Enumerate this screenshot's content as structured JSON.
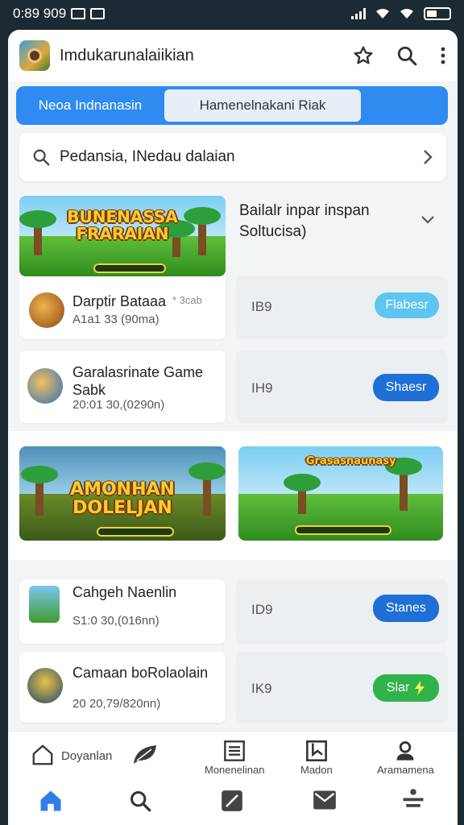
{
  "status": {
    "time": "0:89 909"
  },
  "app": {
    "title": "Imdukarunalaiikian"
  },
  "tabs": [
    {
      "label": "Neoa Indnanasin",
      "active": true
    },
    {
      "label": "Hamenelnakani Riak",
      "active": false
    }
  ],
  "search": {
    "text": "Pedansia, INedau dalaian"
  },
  "section": {
    "heading": "Bailalr inpar inspan Soltucisa)"
  },
  "banners": [
    {
      "title": "BUNENASSA FRARAIAN"
    },
    {
      "title": "AMONHAN DOLELJAN"
    },
    {
      "title": "Grasasnaunasy"
    }
  ],
  "rows": [
    {
      "title": "Darptir Bataaa",
      "tag": "* 3cab",
      "sub": "A1a1 33 (90ma)",
      "num": "IB9",
      "button": "Flabesr",
      "button_color": "#5ec4f2"
    },
    {
      "title": "Garalasrinate Game Sabk",
      "sub": "20:01 30,(0290n)",
      "num": "IH9",
      "button": "Shaesr",
      "button_color": "#1f6fd6"
    },
    {
      "title": "Cahgeh Naenlin",
      "sub": "S1:0 30,(016nn)",
      "num": "ID9",
      "button": "Stanes",
      "button_color": "#1f6fd6"
    },
    {
      "title": "Camaan boRolaolain",
      "sub": "20 20,79/820nn)",
      "num": "IK9",
      "button": "Slar",
      "button_color": "#2fb34a"
    }
  ],
  "nav": {
    "top": [
      {
        "label": "Doyanlan",
        "icon": "home-outline-icon"
      },
      {
        "label": "",
        "icon": "leaf-icon"
      },
      {
        "label": "Monenelinan",
        "icon": "list-icon"
      },
      {
        "label": "Madon",
        "icon": "bookmark-icon"
      },
      {
        "label": "Aramamena",
        "icon": "person-icon"
      }
    ],
    "bottom": [
      {
        "icon": "home-icon"
      },
      {
        "icon": "search-icon"
      },
      {
        "icon": "edit-icon"
      },
      {
        "icon": "mail-icon"
      },
      {
        "icon": "menu-icon"
      }
    ]
  },
  "colors": {
    "accent": "#2f8bf0",
    "background": "#f2f4f6"
  }
}
